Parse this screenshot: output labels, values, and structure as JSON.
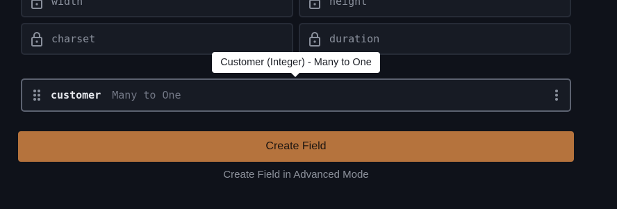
{
  "fields": [
    {
      "name": "width",
      "icon": "lock-icon"
    },
    {
      "name": "height",
      "icon": "lock-icon"
    },
    {
      "name": "charset",
      "icon": "lock-icon"
    },
    {
      "name": "duration",
      "icon": "lock-icon"
    }
  ],
  "relation_field": {
    "name": "customer",
    "type": "Many to One",
    "drag_icon": "drag-handle-icon",
    "menu_icon": "more-vertical-icon"
  },
  "tooltip": {
    "text": "Customer (Integer) - Many to One"
  },
  "actions": {
    "create_label": "Create Field",
    "advanced_label": "Create Field in Advanced Mode"
  },
  "colors": {
    "background": "#0f121a",
    "field_bg": "#171b24",
    "accent": "#b5733d",
    "tooltip_bg": "#ffffff"
  }
}
